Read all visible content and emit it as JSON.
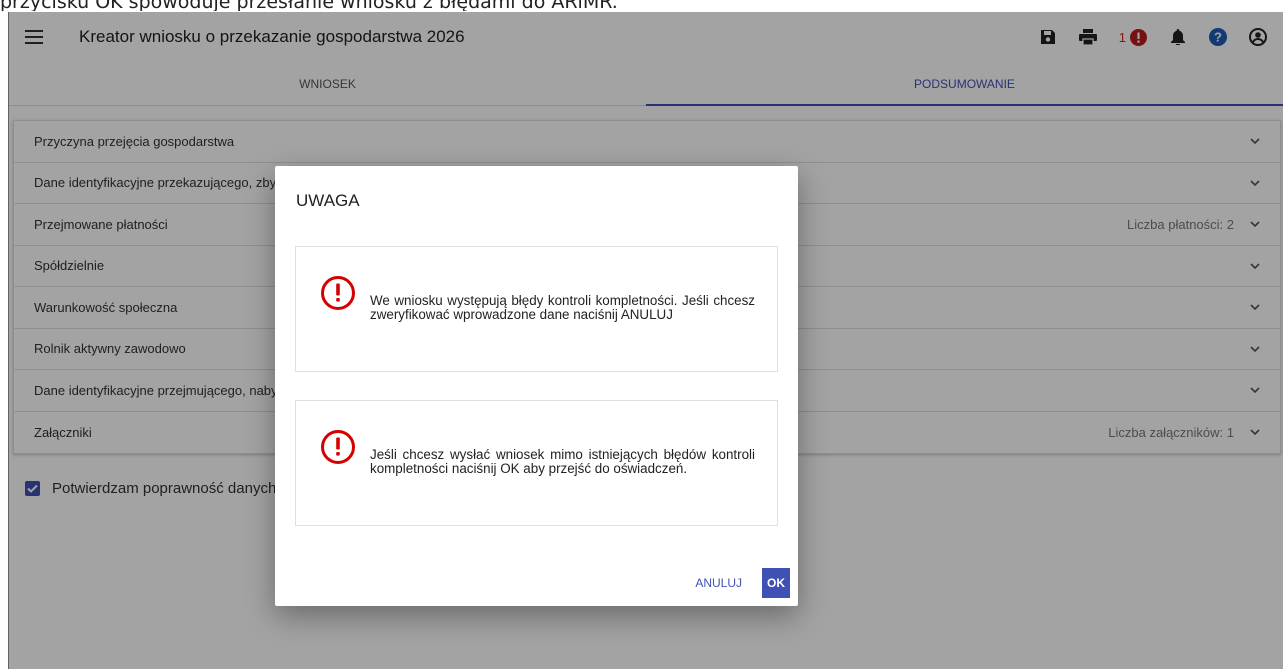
{
  "caption": "przycisku OK spowoduje przesłanie wniosku z błędami do ARiMR.",
  "app": {
    "title": "Kreator wniosku o przekazanie gospodarstwa 2026",
    "error_count": "1"
  },
  "tabs": [
    {
      "label": "WNIOSEK"
    },
    {
      "label": "PODSUMOWANIE"
    }
  ],
  "panels": [
    {
      "label": "Przyczyna przejęcia gospodarstwa",
      "meta": ""
    },
    {
      "label": "Dane identyfikacyjne przekazującego, zbywającego",
      "meta": ""
    },
    {
      "label": "Przejmowane płatności",
      "meta": "Liczba płatności: 2"
    },
    {
      "label": "Spółdzielnie",
      "meta": ""
    },
    {
      "label": "Warunkowość społeczna",
      "meta": ""
    },
    {
      "label": "Rolnik aktywny zawodowo",
      "meta": ""
    },
    {
      "label": "Dane identyfikacyjne przejmującego, nabywającego",
      "meta": ""
    },
    {
      "label": "Załączniki",
      "meta": "Liczba załączników: 1"
    }
  ],
  "confirm": {
    "label": "Potwierdzam poprawność danych",
    "checked": true
  },
  "dialog": {
    "title": "UWAGA",
    "message_1": "We wniosku występują błędy kontroli kompletności. Jeśli chcesz zweryfikować wprowadzone dane naciśnij ANULUJ",
    "message_2": "Jeśli chcesz wysłać wniosek mimo istniejących błędów kontroli kompletności naciśnij OK aby przejść do oświadczeń.",
    "cancel_label": "ANULUJ",
    "ok_label": "OK"
  },
  "colors": {
    "primary": "#3f51b5",
    "error": "#d50000",
    "overlay": "rgba(0,0,0,0.36)"
  },
  "icons": [
    "menu-icon",
    "save-icon",
    "print-icon",
    "error-icon",
    "bell-icon",
    "help-icon",
    "account-icon",
    "chevron-down-icon",
    "warning-icon",
    "check-icon"
  ]
}
